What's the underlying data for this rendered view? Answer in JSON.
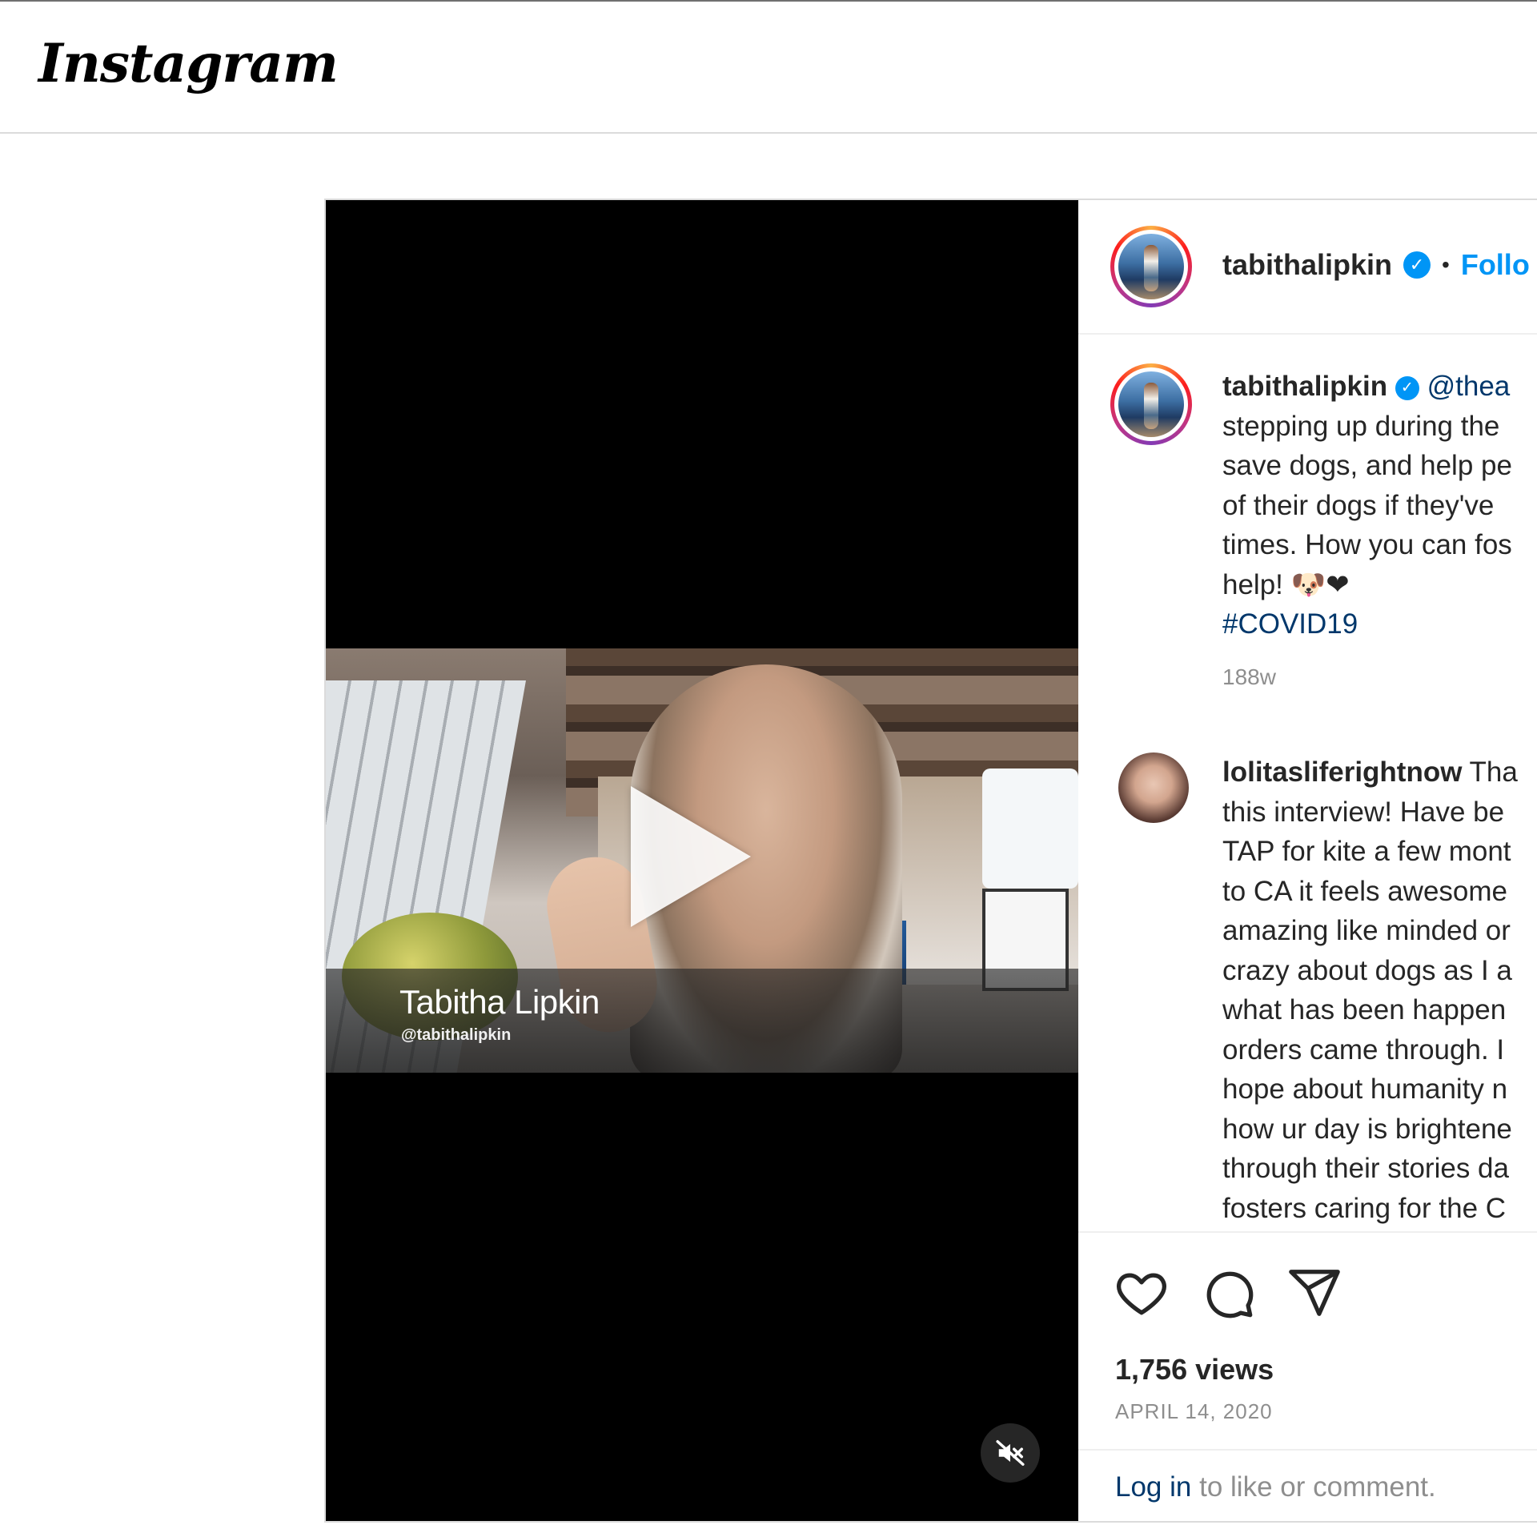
{
  "app": {
    "logo_text": "Instagram"
  },
  "video": {
    "overlay_name": "Tabitha Lipkin",
    "overlay_handle": "@tabithalipkin",
    "play_icon": "play-icon",
    "mute_icon": "muted-speaker-icon"
  },
  "post_header": {
    "username": "tabithalipkin",
    "verified_icon": "verified-badge-icon",
    "separator": "•",
    "follow_label": "Follo"
  },
  "caption": {
    "username": "tabithalipkin",
    "mention": "@thea",
    "lines": [
      "stepping up during the",
      "save dogs, and help pe",
      "of their dogs if they've",
      "times. How you can fos",
      "help! 🐶❤"
    ],
    "hashtag": "#COVID19",
    "time_ago": "188w"
  },
  "comment": {
    "username": "lolitasliferightnow",
    "first_word": "Tha",
    "lines": [
      "this interview! Have be",
      "TAP for kite a few mont",
      "to CA it feels awesome",
      "amazing like minded or",
      "crazy about dogs as I a",
      "what has been happen",
      "orders came through. I",
      "hope about humanity n",
      "how ur day is brightene",
      "through their stories da",
      "fosters caring for the C"
    ]
  },
  "actions": {
    "like_icon": "heart-icon",
    "comment_icon": "comment-bubble-icon",
    "share_icon": "paper-plane-icon",
    "views": "1,756 views",
    "date": "APRIL 14, 2020",
    "login_link": "Log in",
    "login_suffix": " to like or comment."
  },
  "colors": {
    "link_blue": "#0095f6",
    "text_dark": "#262626",
    "muted": "#8e8e8e",
    "hashtag": "#00376b"
  }
}
